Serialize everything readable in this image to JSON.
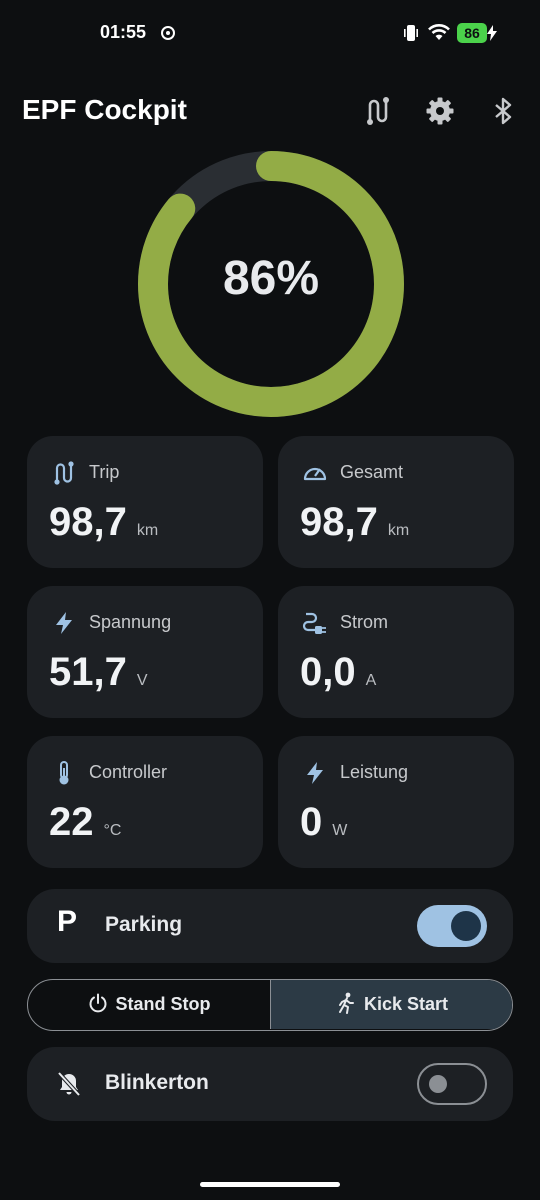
{
  "status": {
    "time": "01:55",
    "battery": "86"
  },
  "header": {
    "title": "EPF Cockpit",
    "icons": [
      "route-icon",
      "gear-icon",
      "bluetooth-icon"
    ]
  },
  "gauge": {
    "value_text": "86%",
    "fraction": 0.86,
    "color": "#93ac46",
    "track_color": "#2a2e33"
  },
  "cards": [
    {
      "id": "trip",
      "label": "Trip",
      "value": "98,7",
      "unit": "km",
      "icon": "route-icon"
    },
    {
      "id": "gesamt",
      "label": "Gesamt",
      "value": "98,7",
      "unit": "km",
      "icon": "speedometer-icon"
    },
    {
      "id": "spannung",
      "label": "Spannung",
      "value": "51,7",
      "unit": "V",
      "icon": "bolt-icon"
    },
    {
      "id": "strom",
      "label": "Strom",
      "value": "0,0",
      "unit": "A",
      "icon": "plug-icon"
    },
    {
      "id": "controller",
      "label": "Controller",
      "value": "22",
      "unit": "°C",
      "icon": "thermometer-icon"
    },
    {
      "id": "leistung",
      "label": "Leistung",
      "value": "0",
      "unit": "W",
      "icon": "bolt-icon"
    }
  ],
  "parking": {
    "letter": "P",
    "label": "Parking",
    "enabled": true
  },
  "mode": {
    "left_label": "Stand Stop",
    "right_label": "Kick Start",
    "selected": "Kick Start"
  },
  "blinker": {
    "label": "Blinkerton",
    "enabled": false
  },
  "colors": {
    "background": "#0d0f11",
    "card": "#1d2024",
    "accent": "#9fc2e3",
    "battery_green": "#4bd24b"
  }
}
